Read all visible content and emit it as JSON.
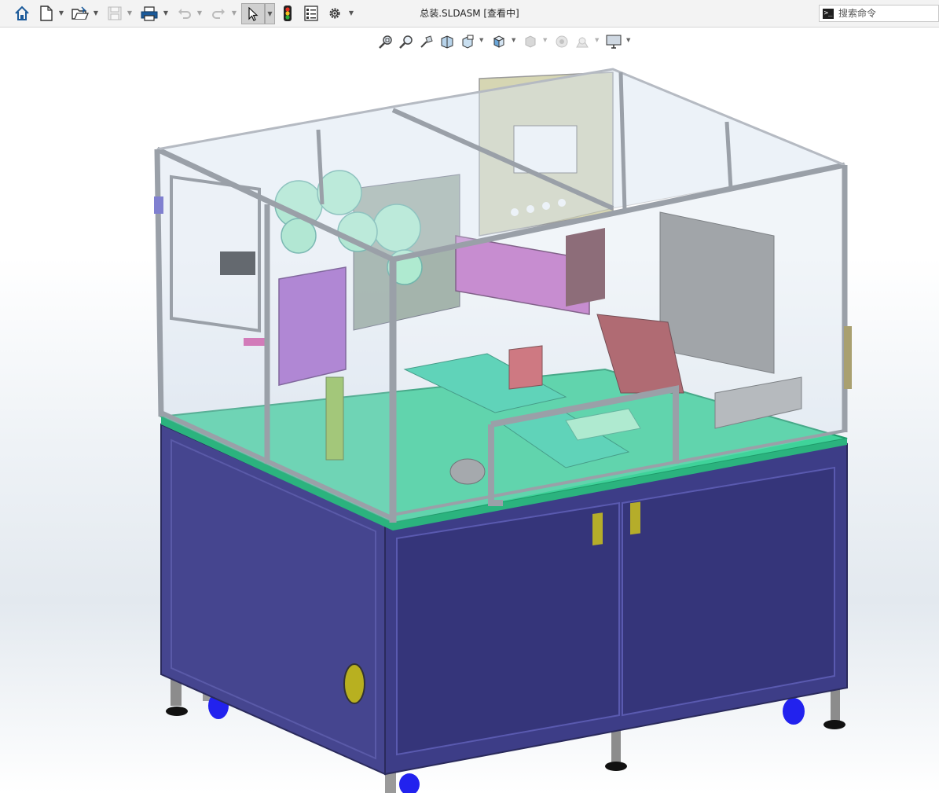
{
  "titlebar": {
    "document_title": "总装.SLDASM [查看中]",
    "buttons": [
      {
        "name": "home-button",
        "icon": "home-icon"
      },
      {
        "name": "new-document-button",
        "icon": "new-file-icon"
      },
      {
        "name": "open-button",
        "icon": "open-folder-icon"
      },
      {
        "name": "save-button",
        "icon": "save-icon",
        "disabled": true
      },
      {
        "name": "print-button",
        "icon": "printer-icon"
      },
      {
        "name": "undo-button",
        "icon": "undo-icon",
        "disabled": true
      },
      {
        "name": "redo-button",
        "icon": "redo-icon",
        "disabled": true
      },
      {
        "name": "select-button",
        "icon": "cursor-arrow-icon",
        "active": true
      },
      {
        "name": "rebuild-button",
        "icon": "traffic-light-icon"
      },
      {
        "name": "file-properties-button",
        "icon": "file-properties-icon"
      },
      {
        "name": "options-button",
        "icon": "gear-icon"
      }
    ]
  },
  "search": {
    "placeholder": "搜索命令",
    "icon": "command-prompt-icon"
  },
  "heads_up_toolbar": [
    {
      "name": "zoom-to-fit",
      "icon": "zoom-fit-icon"
    },
    {
      "name": "zoom-to-area",
      "icon": "zoom-area-icon"
    },
    {
      "name": "previous-view",
      "icon": "previous-view-icon"
    },
    {
      "name": "section-view",
      "icon": "section-view-icon"
    },
    {
      "name": "dynamic-annotation-view",
      "icon": "annotation-view-icon"
    },
    {
      "name": "view-orientation",
      "icon": "cube-view-icon"
    },
    {
      "name": "display-style",
      "icon": "display-style-icon"
    },
    {
      "name": "hide-show-items",
      "icon": "eye-icon"
    },
    {
      "name": "edit-appearance",
      "icon": "appearance-sphere-icon"
    },
    {
      "name": "apply-scene",
      "icon": "scene-icon"
    },
    {
      "name": "view-settings",
      "icon": "monitor-icon"
    }
  ],
  "colors": {
    "cabinet": "#41418e",
    "cabinet_dark": "#2f2f6e",
    "deck": "#3fd39a",
    "frame": "#9aa0a8",
    "glass": "#c9d8e8",
    "accent_green": "#a7f0c8",
    "accent_pink": "#b85cc6",
    "accent_red": "#a8474c",
    "caster_blue": "#2222ee"
  }
}
